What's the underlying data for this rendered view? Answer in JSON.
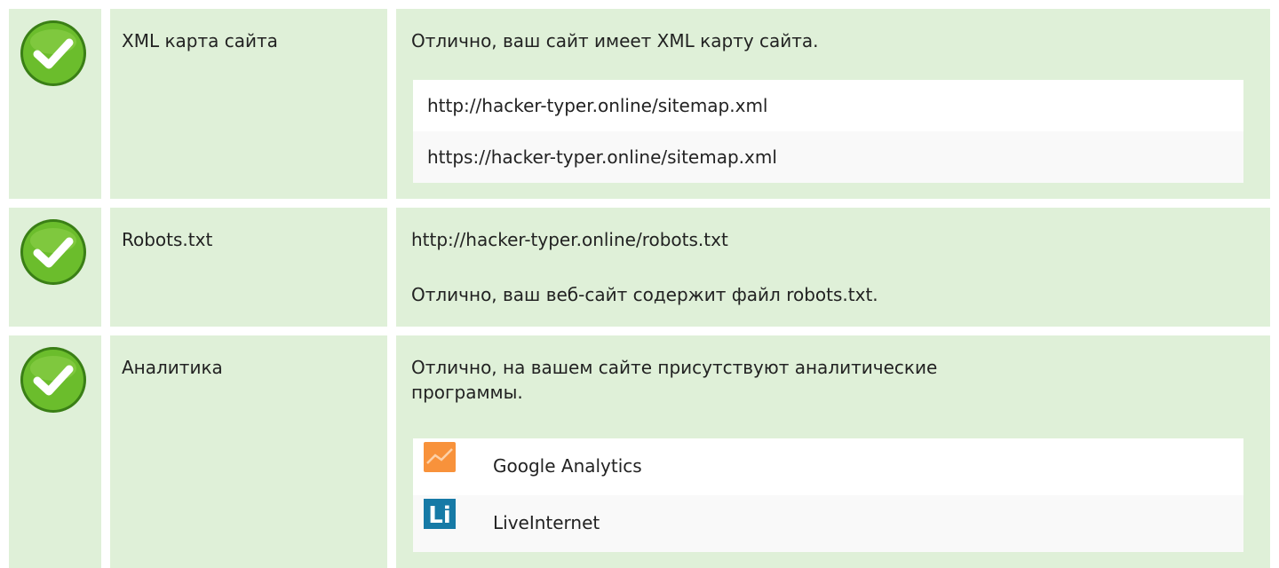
{
  "colors": {
    "row_background": "#dff0d8",
    "check_green": "#6bbd2c",
    "check_border": "#3a7f16",
    "ga_orange": "#f8923b",
    "li_blue": "#167aa6"
  },
  "rows": [
    {
      "status_icon": "check-icon",
      "name": "XML карта сайта",
      "message": "Отлично, ваш сайт имеет XML карту сайта.",
      "items": [
        "http://hacker-typer.online/sitemap.xml",
        "https://hacker-typer.online/sitemap.xml"
      ]
    },
    {
      "status_icon": "check-icon",
      "name": "Robots.txt",
      "url": "http://hacker-typer.online/robots.txt",
      "message": "Отлично, ваш веб-сайт содержит файл robots.txt."
    },
    {
      "status_icon": "check-icon",
      "name": "Аналитика",
      "message_line1": "Отлично, на вашем сайте присутствуют аналитические",
      "message_line2": "программы.",
      "items": [
        {
          "icon": "google-analytics-icon",
          "label": "Google Analytics"
        },
        {
          "icon": "liveinternet-icon",
          "label": "LiveInternet",
          "icon_text": "Li"
        }
      ]
    }
  ]
}
